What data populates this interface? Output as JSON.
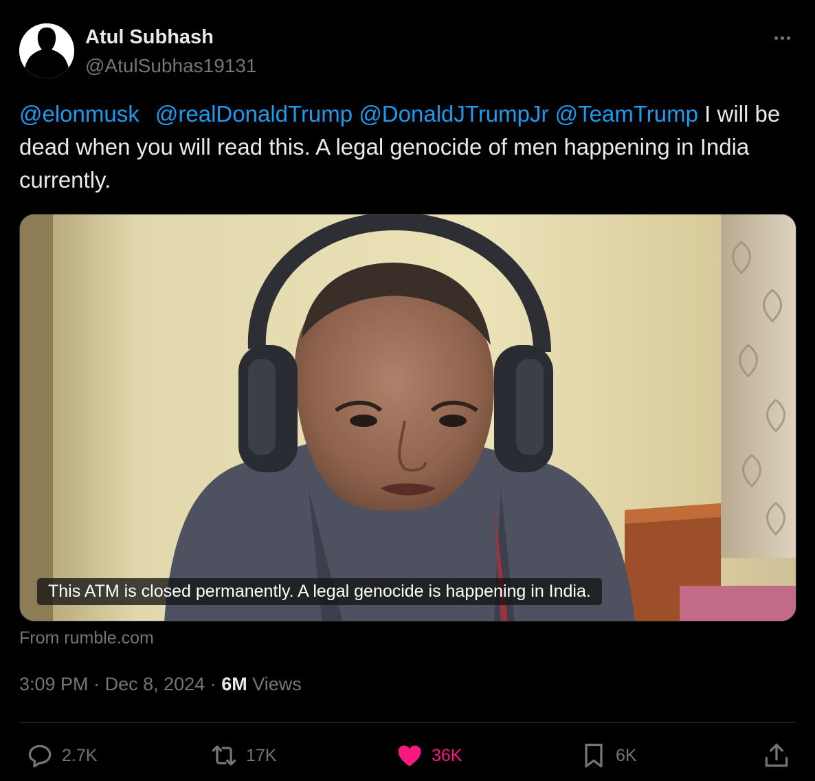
{
  "author": {
    "name": "Atul Subhash",
    "handle": "@AtulSubhas19131"
  },
  "more_icon": "more-horizontal-icon",
  "tweet": {
    "mentions": [
      "@elonmusk",
      "@realDonaldTrump",
      "@DonaldJTrumpJr",
      "@TeamTrump"
    ],
    "body": "I will be dead when you will read this. A legal genocide of men happening in India currently."
  },
  "media": {
    "caption": "This ATM is closed permanently. A legal genocide is happening in India.",
    "source": "From rumble.com"
  },
  "meta": {
    "time": "3:09 PM",
    "separator": "·",
    "date": "Dec 8, 2024",
    "views_count": "6M",
    "views_label": "Views"
  },
  "actions": {
    "replies": "2.7K",
    "reposts": "17K",
    "likes": "36K",
    "bookmarks": "6K"
  },
  "colors": {
    "background": "#000000",
    "text": "#e7e9ea",
    "muted": "#71767b",
    "link": "#1d9bf0",
    "like": "#f91880",
    "border": "#2f3336"
  }
}
